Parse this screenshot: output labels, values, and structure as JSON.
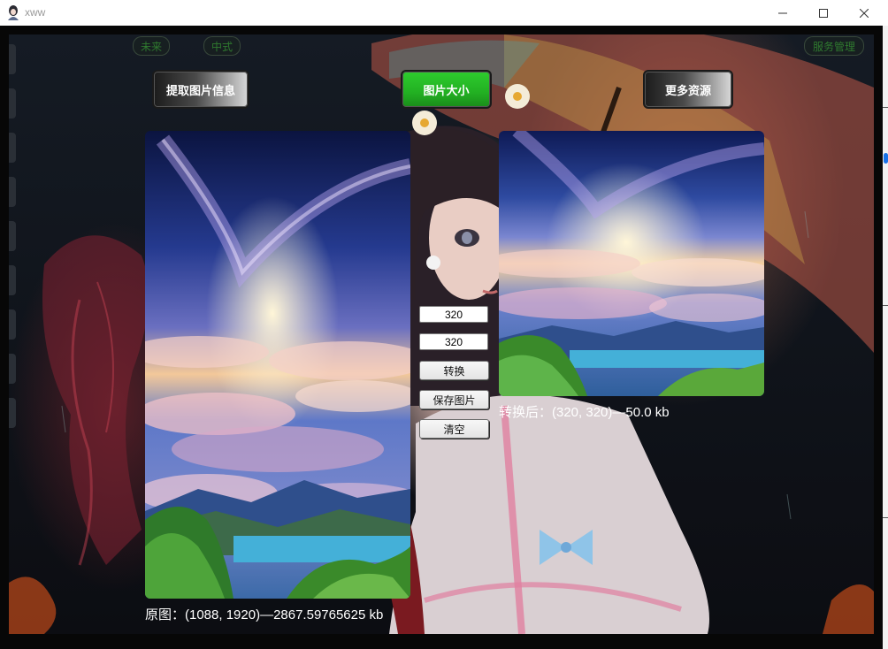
{
  "window": {
    "title": "xww"
  },
  "ghost_tabs": {
    "left1": "未来",
    "left2": "中式",
    "right": "服务管理"
  },
  "toolbar": {
    "extract_label": "提取图片信息",
    "resize_label": "图片大小",
    "more_label": "更多资源"
  },
  "resize": {
    "width_value": "320",
    "height_value": "320",
    "convert_label": "转换",
    "save_label": "保存图片",
    "clear_label": "清空"
  },
  "captions": {
    "original": "原图：(1088, 1920)—2867.59765625 kb",
    "converted": "转换后：(320, 320)—50.0 kb"
  },
  "colors": {
    "accent_green": "#22b022",
    "window_bg": "#070707"
  }
}
